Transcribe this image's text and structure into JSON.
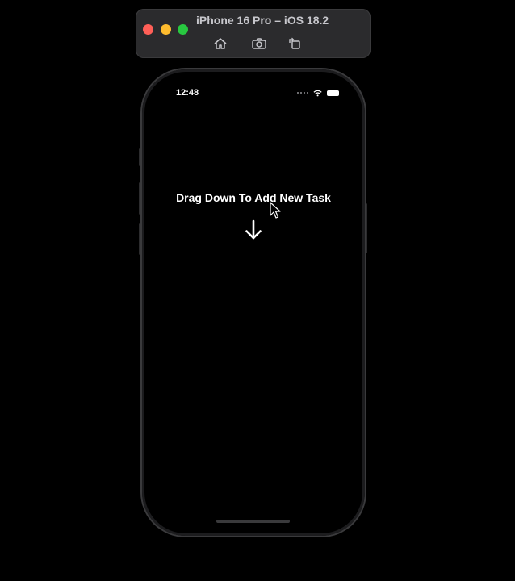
{
  "simulator": {
    "title": "iPhone 16 Pro – iOS 18.2",
    "traffic_colors": {
      "close": "#ff5f57",
      "minimize": "#febc2e",
      "zoom": "#28c840"
    },
    "buttons": [
      {
        "icon": "home-icon"
      },
      {
        "icon": "screenshot-icon"
      },
      {
        "icon": "rotate-icon"
      }
    ]
  },
  "status_bar": {
    "time": "12:48",
    "icons": [
      "signal-icon",
      "wifi-icon",
      "battery-icon"
    ]
  },
  "main": {
    "headline": "Drag Down To Add New Task",
    "arrow_icon": "arrow-down-icon"
  },
  "colors": {
    "background": "#000000",
    "text": "#ffffff"
  }
}
